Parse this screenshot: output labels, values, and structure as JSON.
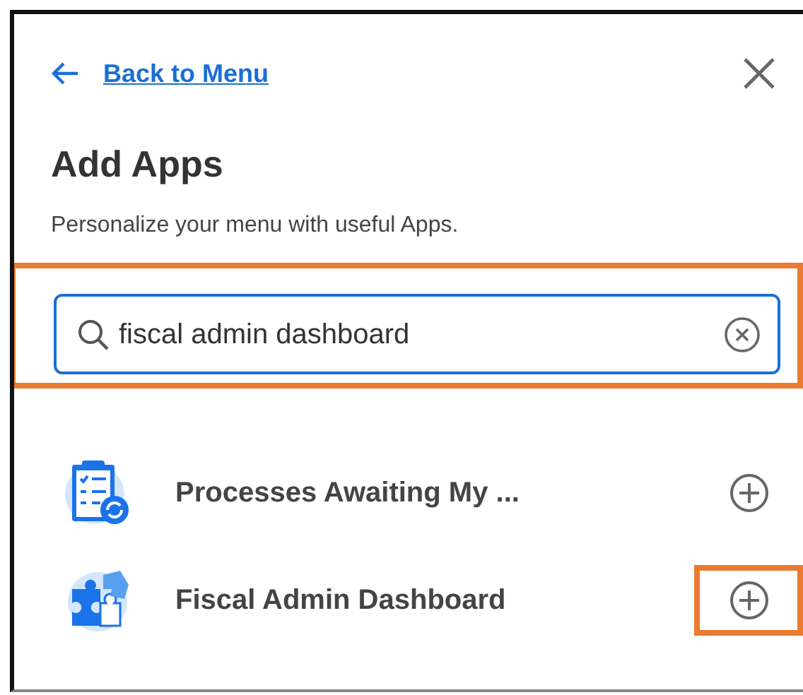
{
  "back_link": {
    "label": "Back to Menu"
  },
  "title": "Add Apps",
  "subtitle": "Personalize your menu with useful Apps.",
  "search": {
    "value": "fiscal admin dashboard",
    "highlighted": true
  },
  "apps": [
    {
      "name": "Processes Awaiting My ...",
      "kind": "clipboard",
      "highlighted": false
    },
    {
      "name": "Fiscal Admin Dashboard",
      "kind": "puzzle",
      "highlighted": true
    }
  ]
}
